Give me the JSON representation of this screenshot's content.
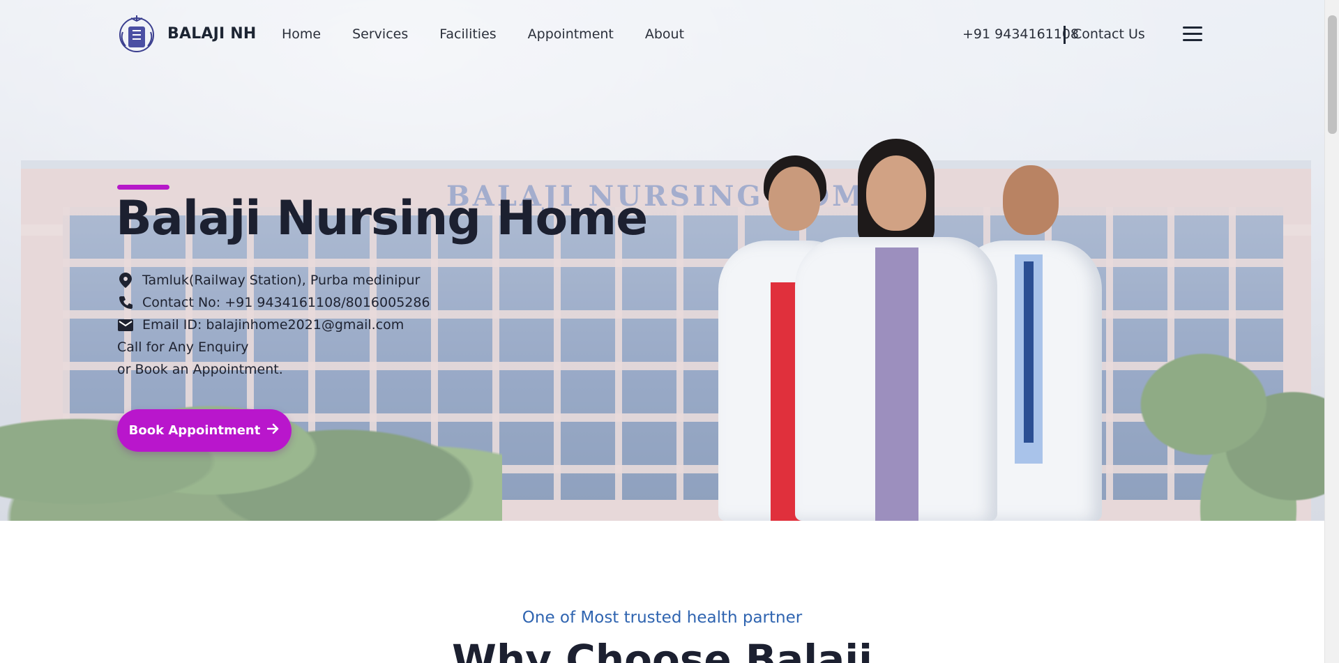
{
  "nav": {
    "brand": "BALAJI NH",
    "items": [
      "Home",
      "Services",
      "Facilities",
      "Appointment",
      "About"
    ],
    "phone": "+91 9434161108",
    "contact_label": "Contact Us"
  },
  "hero": {
    "building_sign": "BALAJI NURSING HOME",
    "title": "Balaji Nursing Home",
    "address": "Tamluk(Railway Station), Purba medinipur",
    "contact": "Contact No: +91 9434161108/8016005286",
    "email": "Email ID: balajinhome2021@gmail.com",
    "enquiry_line1": "Call for Any Enquiry",
    "enquiry_line2": "or Book an Appointment.",
    "button_label": "Book Appointment"
  },
  "section": {
    "subtitle": "One of Most trusted health partner",
    "title": "Why Choose Balaji"
  },
  "colors": {
    "accent": "#b916cc",
    "subtitle_blue": "#2f64b0",
    "text_dark": "#1c2030"
  },
  "icons": {
    "location": "location-pin-icon",
    "phone": "phone-icon",
    "email": "mail-icon",
    "arrow": "arrow-right-icon",
    "menu": "hamburger-menu-icon"
  }
}
